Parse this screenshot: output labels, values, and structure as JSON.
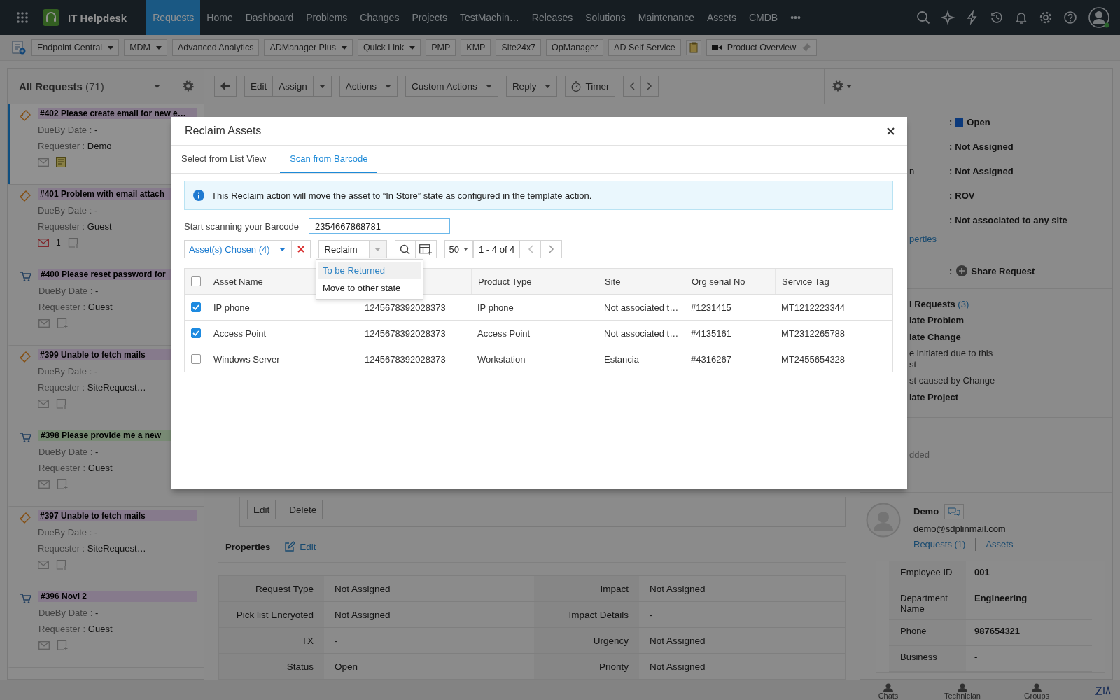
{
  "app": {
    "title": "IT Helpdesk"
  },
  "nav": [
    {
      "label": "Requests",
      "selected": true
    },
    {
      "label": "Home",
      "selected": false
    },
    {
      "label": "Dashboard",
      "selected": false
    },
    {
      "label": "Problems",
      "selected": false
    },
    {
      "label": "Changes",
      "selected": false
    },
    {
      "label": "Projects",
      "selected": false
    },
    {
      "label": "TestMachin…",
      "selected": false
    },
    {
      "label": "Releases",
      "selected": false
    },
    {
      "label": "Solutions",
      "selected": false
    },
    {
      "label": "Maintenance",
      "selected": false
    },
    {
      "label": "Assets",
      "selected": false
    },
    {
      "label": "CMDB",
      "selected": false
    },
    {
      "label": "•••",
      "selected": false
    }
  ],
  "quick_links": [
    {
      "label": "Endpoint Central",
      "dropdown": true
    },
    {
      "label": "MDM",
      "dropdown": true
    },
    {
      "label": "Advanced Analytics",
      "dropdown": false
    },
    {
      "label": "ADManager Plus",
      "dropdown": true
    },
    {
      "label": "Quick Link",
      "dropdown": true
    },
    {
      "label": "PMP",
      "dropdown": false
    },
    {
      "label": "KMP",
      "dropdown": false
    },
    {
      "label": "Site24x7",
      "dropdown": false
    },
    {
      "label": "OpManager",
      "dropdown": false
    },
    {
      "label": "AD Self Service",
      "dropdown": false
    }
  ],
  "product_overview": "Product Overview",
  "request_list": {
    "title": "All Requests",
    "count": "(71)",
    "items": [
      {
        "kind": "incident",
        "title": "#402 Please create email for new e…",
        "color": "#867a8c",
        "selected": true,
        "dueby_label": "DueBy Date :",
        "dueby": "-",
        "requester_label": "Requester :",
        "requester": "Demo",
        "has_note": true
      },
      {
        "kind": "incident",
        "title": "#401 Problem with email attach",
        "color": "#867a8c",
        "selected": false,
        "dueby_label": "DueBy Date :",
        "dueby": "-",
        "requester_label": "Requester :",
        "requester": "Guest",
        "has_note": false,
        "unread_count": "1"
      },
      {
        "kind": "service",
        "title": "#400 Please reset password for",
        "color": "#867a8c",
        "selected": false,
        "dueby_label": "DueBy Date :",
        "dueby": "-",
        "requester_label": "Requester :",
        "requester": "Guest",
        "has_note": false
      },
      {
        "kind": "incident",
        "title": "#399 Unable to fetch mails",
        "color": "#867a8c",
        "selected": false,
        "dueby_label": "DueBy Date :",
        "dueby": "-",
        "requester_label": "Requester :",
        "requester": "SiteRequest…",
        "has_note": false
      },
      {
        "kind": "service",
        "title": "#398 Please provide me a new",
        "color": "#788a74",
        "selected": false,
        "dueby_label": "DueBy Date :",
        "dueby": "-",
        "requester_label": "Requester :",
        "requester": "Guest",
        "has_note": false
      },
      {
        "kind": "incident",
        "title": "#397 Unable to fetch mails",
        "color": "#867a8c",
        "selected": false,
        "dueby_label": "DueBy Date :",
        "dueby": "-",
        "requester_label": "Requester :",
        "requester": "SiteRequest…",
        "has_note": false
      },
      {
        "kind": "service",
        "title": "#396 Novi 2",
        "color": "#867a8c",
        "selected": false,
        "dueby_label": "DueBy Date :",
        "dueby": "-",
        "requester_label": "Requester :",
        "requester": "Guest",
        "has_note": false
      }
    ]
  },
  "detail_toolbar": {
    "edit": "Edit",
    "assign": "Assign",
    "actions": "Actions",
    "custom_actions": "Custom Actions",
    "reply": "Reply",
    "timer": "Timer"
  },
  "detail": {
    "buttons": [
      "Edit",
      "Delete"
    ],
    "properties_title": "Properties",
    "properties_edit": "Edit",
    "properties": [
      {
        "label": "Request Type",
        "value": "Not Assigned",
        "label_2": "Impact",
        "value_2": "Not Assigned"
      },
      {
        "label": "Pick list Encryoted",
        "value": "Not Assigned",
        "label_2": "Impact Details",
        "value_2": "-"
      },
      {
        "label": "TX",
        "value": "-",
        "label_2": "Urgency",
        "value_2": "Not Assigned"
      },
      {
        "label": "Status",
        "value": "Open",
        "label_2": "Priority",
        "value_2": "Not Assigned"
      }
    ]
  },
  "right_panel": {
    "fields": [
      {
        "kind": "status",
        "separator": ":",
        "value": "Open"
      },
      {
        "kind": "text",
        "separator": ":",
        "value": "Not Assigned"
      },
      {
        "kind": "text",
        "label": "n",
        "separator": ":",
        "value": "Not Assigned"
      },
      {
        "kind": "text",
        "separator": ":",
        "value": "ROV"
      },
      {
        "kind": "text",
        "separator": ":",
        "value": "Not associated to any site"
      }
    ],
    "properties_link": "perties",
    "share_separator": ":",
    "share": "Share Request",
    "linked_title": "l Requests",
    "linked_count": "(3)",
    "links": [
      {
        "text": "iate Problem",
        "bold": true
      },
      {
        "text": "iate Change",
        "bold": true
      },
      {
        "text": "e initiated due to this\nst",
        "bold": false
      },
      {
        "text": "st caused by Change",
        "bold": false
      },
      {
        "text": "iate Project",
        "bold": true
      }
    ],
    "added_note": "dded",
    "requester": {
      "name": "Demo",
      "email": "demo@sdplinmail.com",
      "requests_link": "Requests (1)",
      "assets_link": "Assets",
      "details": [
        {
          "label": "Employee ID",
          "value": "001"
        },
        {
          "label": "Department Name",
          "value": "Engineering"
        },
        {
          "label": "Phone",
          "value": "987654321"
        },
        {
          "label": "Business",
          "value": "-"
        }
      ]
    }
  },
  "bottom_bar": [
    "Chats",
    "Technician",
    "Groups"
  ],
  "modal": {
    "title": "Reclaim Assets",
    "tabs": [
      {
        "label": "Select from List View",
        "selected": false
      },
      {
        "label": "Scan from Barcode",
        "selected": true
      }
    ],
    "info": "This Reclaim action will move the asset to “In Store” state as configured in the template action.",
    "scan_label": "Start scanning your Barcode",
    "scan_value": "2354667868781",
    "chosen": "Asset(s) Chosen (4)",
    "action": "Reclaim",
    "page_size": "50",
    "range": "1 - 4 of 4",
    "menu": [
      {
        "label": "To be Returned",
        "selected": true
      },
      {
        "label": "Move to other state",
        "selected": false
      }
    ],
    "table": {
      "header_checked": false,
      "headers": {
        "asset_name": "Asset Name",
        "product_type": "Product Type",
        "site": "Site",
        "org_serial_no": "Org serial No",
        "service_tag": "Service Tag"
      },
      "rows": [
        {
          "checked": true,
          "asset_name": "IP phone",
          "column_3": "1245678392028373",
          "product_type": "IP phone",
          "site": "Not associated t…",
          "org_serial_no": "#1231415",
          "service_tag": "MT1212223344"
        },
        {
          "checked": true,
          "asset_name": "Access Point",
          "column_3": "1245678392028373",
          "product_type": "Access Point",
          "site": "Not associated t…",
          "org_serial_no": "#4135161",
          "service_tag": "MT2312265788"
        },
        {
          "checked": false,
          "asset_name": "Windows Server",
          "column_3": "1245678392028373",
          "product_type": "Workstation",
          "site": "Estancia",
          "org_serial_no": "#4316267",
          "service_tag": "MT2455654328"
        }
      ]
    }
  }
}
